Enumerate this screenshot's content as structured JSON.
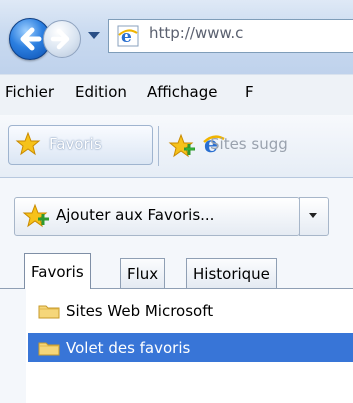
{
  "address": {
    "text": "http://www.c"
  },
  "menu": {
    "items": [
      "Fichier",
      "Edition",
      "Affichage",
      "F"
    ]
  },
  "favorites_toolbar": {
    "favorites_button_label": "Favoris",
    "suggested_sites_label": "Sites sugg"
  },
  "favorites_pane": {
    "add_button_label": "Ajouter aux Favoris...",
    "tabs": [
      "Favoris",
      "Flux",
      "Historique"
    ],
    "active_tab": "Favoris",
    "items": [
      {
        "label": "Sites Web Microsoft",
        "selected": false
      },
      {
        "label": "Volet des favoris",
        "selected": true
      }
    ]
  },
  "colors": {
    "selection": "#3875d7",
    "chrome_blue": "#c9daf0"
  }
}
